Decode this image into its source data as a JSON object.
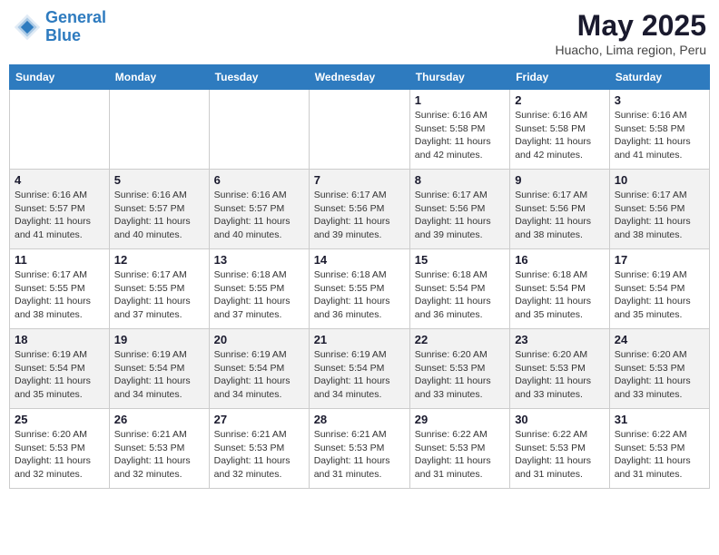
{
  "header": {
    "logo_line1": "General",
    "logo_line2": "Blue",
    "month_year": "May 2025",
    "location": "Huacho, Lima region, Peru"
  },
  "weekdays": [
    "Sunday",
    "Monday",
    "Tuesday",
    "Wednesday",
    "Thursday",
    "Friday",
    "Saturday"
  ],
  "weeks": [
    [
      {
        "day": "",
        "info": ""
      },
      {
        "day": "",
        "info": ""
      },
      {
        "day": "",
        "info": ""
      },
      {
        "day": "",
        "info": ""
      },
      {
        "day": "1",
        "info": "Sunrise: 6:16 AM\nSunset: 5:58 PM\nDaylight: 11 hours\nand 42 minutes."
      },
      {
        "day": "2",
        "info": "Sunrise: 6:16 AM\nSunset: 5:58 PM\nDaylight: 11 hours\nand 42 minutes."
      },
      {
        "day": "3",
        "info": "Sunrise: 6:16 AM\nSunset: 5:58 PM\nDaylight: 11 hours\nand 41 minutes."
      }
    ],
    [
      {
        "day": "4",
        "info": "Sunrise: 6:16 AM\nSunset: 5:57 PM\nDaylight: 11 hours\nand 41 minutes."
      },
      {
        "day": "5",
        "info": "Sunrise: 6:16 AM\nSunset: 5:57 PM\nDaylight: 11 hours\nand 40 minutes."
      },
      {
        "day": "6",
        "info": "Sunrise: 6:16 AM\nSunset: 5:57 PM\nDaylight: 11 hours\nand 40 minutes."
      },
      {
        "day": "7",
        "info": "Sunrise: 6:17 AM\nSunset: 5:56 PM\nDaylight: 11 hours\nand 39 minutes."
      },
      {
        "day": "8",
        "info": "Sunrise: 6:17 AM\nSunset: 5:56 PM\nDaylight: 11 hours\nand 39 minutes."
      },
      {
        "day": "9",
        "info": "Sunrise: 6:17 AM\nSunset: 5:56 PM\nDaylight: 11 hours\nand 38 minutes."
      },
      {
        "day": "10",
        "info": "Sunrise: 6:17 AM\nSunset: 5:56 PM\nDaylight: 11 hours\nand 38 minutes."
      }
    ],
    [
      {
        "day": "11",
        "info": "Sunrise: 6:17 AM\nSunset: 5:55 PM\nDaylight: 11 hours\nand 38 minutes."
      },
      {
        "day": "12",
        "info": "Sunrise: 6:17 AM\nSunset: 5:55 PM\nDaylight: 11 hours\nand 37 minutes."
      },
      {
        "day": "13",
        "info": "Sunrise: 6:18 AM\nSunset: 5:55 PM\nDaylight: 11 hours\nand 37 minutes."
      },
      {
        "day": "14",
        "info": "Sunrise: 6:18 AM\nSunset: 5:55 PM\nDaylight: 11 hours\nand 36 minutes."
      },
      {
        "day": "15",
        "info": "Sunrise: 6:18 AM\nSunset: 5:54 PM\nDaylight: 11 hours\nand 36 minutes."
      },
      {
        "day": "16",
        "info": "Sunrise: 6:18 AM\nSunset: 5:54 PM\nDaylight: 11 hours\nand 35 minutes."
      },
      {
        "day": "17",
        "info": "Sunrise: 6:19 AM\nSunset: 5:54 PM\nDaylight: 11 hours\nand 35 minutes."
      }
    ],
    [
      {
        "day": "18",
        "info": "Sunrise: 6:19 AM\nSunset: 5:54 PM\nDaylight: 11 hours\nand 35 minutes."
      },
      {
        "day": "19",
        "info": "Sunrise: 6:19 AM\nSunset: 5:54 PM\nDaylight: 11 hours\nand 34 minutes."
      },
      {
        "day": "20",
        "info": "Sunrise: 6:19 AM\nSunset: 5:54 PM\nDaylight: 11 hours\nand 34 minutes."
      },
      {
        "day": "21",
        "info": "Sunrise: 6:19 AM\nSunset: 5:54 PM\nDaylight: 11 hours\nand 34 minutes."
      },
      {
        "day": "22",
        "info": "Sunrise: 6:20 AM\nSunset: 5:53 PM\nDaylight: 11 hours\nand 33 minutes."
      },
      {
        "day": "23",
        "info": "Sunrise: 6:20 AM\nSunset: 5:53 PM\nDaylight: 11 hours\nand 33 minutes."
      },
      {
        "day": "24",
        "info": "Sunrise: 6:20 AM\nSunset: 5:53 PM\nDaylight: 11 hours\nand 33 minutes."
      }
    ],
    [
      {
        "day": "25",
        "info": "Sunrise: 6:20 AM\nSunset: 5:53 PM\nDaylight: 11 hours\nand 32 minutes."
      },
      {
        "day": "26",
        "info": "Sunrise: 6:21 AM\nSunset: 5:53 PM\nDaylight: 11 hours\nand 32 minutes."
      },
      {
        "day": "27",
        "info": "Sunrise: 6:21 AM\nSunset: 5:53 PM\nDaylight: 11 hours\nand 32 minutes."
      },
      {
        "day": "28",
        "info": "Sunrise: 6:21 AM\nSunset: 5:53 PM\nDaylight: 11 hours\nand 31 minutes."
      },
      {
        "day": "29",
        "info": "Sunrise: 6:22 AM\nSunset: 5:53 PM\nDaylight: 11 hours\nand 31 minutes."
      },
      {
        "day": "30",
        "info": "Sunrise: 6:22 AM\nSunset: 5:53 PM\nDaylight: 11 hours\nand 31 minutes."
      },
      {
        "day": "31",
        "info": "Sunrise: 6:22 AM\nSunset: 5:53 PM\nDaylight: 11 hours\nand 31 minutes."
      }
    ]
  ]
}
